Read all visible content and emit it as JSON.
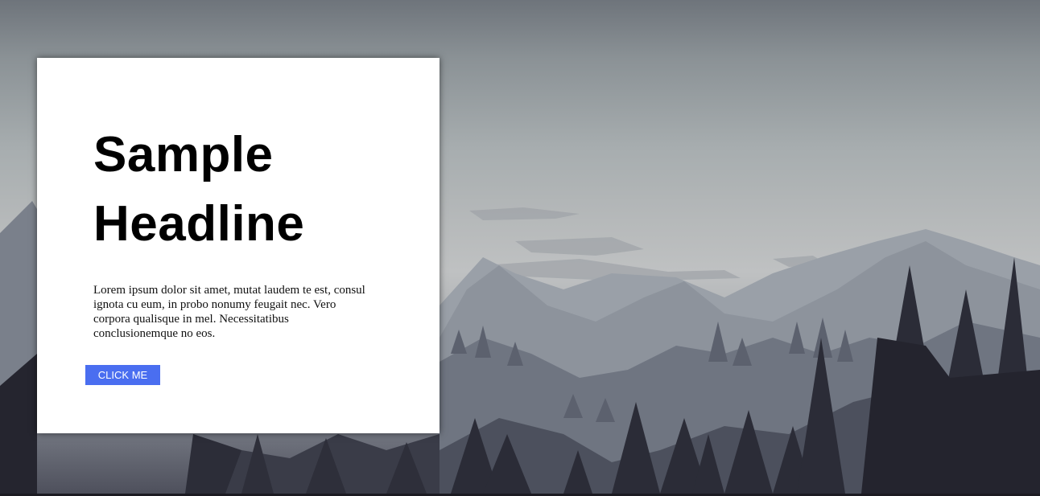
{
  "hero": {
    "headline_line1": "Sample",
    "headline_line2": "Headline",
    "body": "Lorem ipsum dolor sit amet, mutat laudem te est, consul ignota cu eum, in probo nonumy feugait nec. Vero corpora qualisque in mel. Necessitatibus conclusionemque no eos.",
    "button_label": "CLICK ME"
  },
  "colors": {
    "button": "#4a6ef0",
    "card": "#ffffff",
    "headline": "#000000"
  }
}
